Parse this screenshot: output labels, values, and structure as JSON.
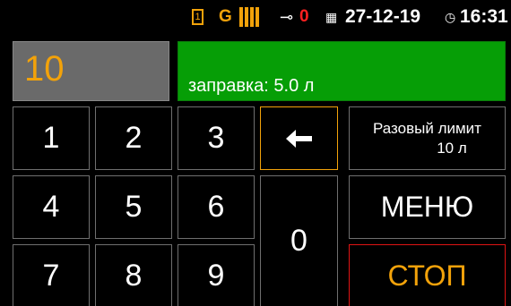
{
  "status": {
    "sim_slot": "1",
    "network": "G",
    "signal_bars": 4,
    "error_count": "0",
    "date": "27-12-19",
    "time": "16:31",
    "icons": [
      "sim-card-icon",
      "signal-bars-icon",
      "power-plug-icon",
      "calendar-icon",
      "clock-icon"
    ]
  },
  "display": {
    "quantity": "10",
    "message": "заправка: 5.0 л"
  },
  "keypad": {
    "k1": "1",
    "k2": "2",
    "k3": "3",
    "k4": "4",
    "k5": "5",
    "k6": "6",
    "k7": "7",
    "k8": "8",
    "k9": "9",
    "k0": "0"
  },
  "actions": {
    "limit_line1": "Разовый лимит",
    "limit_line2": "10 л",
    "menu": "МЕНЮ",
    "stop": "СТОП"
  },
  "colors": {
    "accent": "#f2a20a",
    "info_bg": "#069e06",
    "qty_bg": "#6a6a6a",
    "stop_border": "#e01414"
  }
}
